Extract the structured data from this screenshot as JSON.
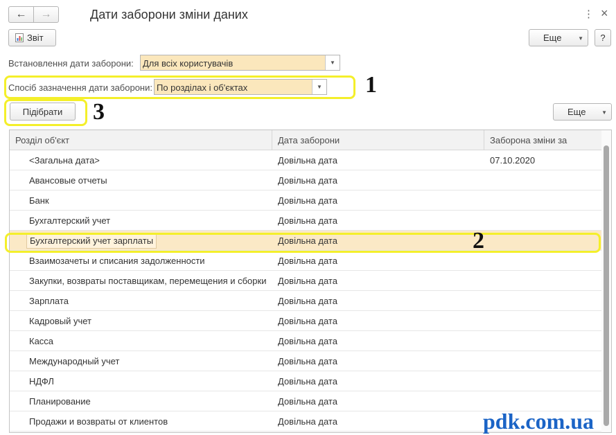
{
  "window": {
    "title": "Дати заборони зміни даних",
    "back_icon": "←",
    "forward_icon": "→",
    "menu_icon": "⋮",
    "close_icon": "×"
  },
  "toolbar": {
    "report_label": "Звіт",
    "more_label": "Еще",
    "help_label": "?"
  },
  "form": {
    "ban_date_label": "Встановлення дати заборони:",
    "ban_date_value": "Для всіх користувачів",
    "method_label": "Спосіб зазначення дати заборони:",
    "method_value": "По розділах і об'єктах"
  },
  "list_toolbar": {
    "pick_label": "Підібрати",
    "more_label": "Еще"
  },
  "table": {
    "columns": [
      "Розділ об'єкт",
      "Дата заборони",
      "Заборона зміни за"
    ],
    "rows": [
      {
        "section": "<Загальна дата>",
        "date_type": "Довільна дата",
        "ban_date": "07.10.2020"
      },
      {
        "section": "Авансовые отчеты",
        "date_type": "Довільна дата",
        "ban_date": ""
      },
      {
        "section": "Банк",
        "date_type": "Довільна дата",
        "ban_date": ""
      },
      {
        "section": "Бухгалтерский учет",
        "date_type": "Довільна дата",
        "ban_date": ""
      },
      {
        "section": "Бухгалтерский учет зарплаты",
        "date_type": "Довільна дата",
        "ban_date": "",
        "selected": true
      },
      {
        "section": "Взаимозачеты и списания задолженности",
        "date_type": "Довільна дата",
        "ban_date": ""
      },
      {
        "section": "Закупки, возвраты поставщикам, перемещения и сборки",
        "date_type": "Довільна дата",
        "ban_date": ""
      },
      {
        "section": "Зарплата",
        "date_type": "Довільна дата",
        "ban_date": ""
      },
      {
        "section": "Кадровый учет",
        "date_type": "Довільна дата",
        "ban_date": ""
      },
      {
        "section": "Касса",
        "date_type": "Довільна дата",
        "ban_date": ""
      },
      {
        "section": "Международный учет",
        "date_type": "Довільна дата",
        "ban_date": ""
      },
      {
        "section": "НДФЛ",
        "date_type": "Довільна дата",
        "ban_date": ""
      },
      {
        "section": "Планирование",
        "date_type": "Довільна дата",
        "ban_date": ""
      },
      {
        "section": "Продажи и возвраты от клиентов",
        "date_type": "Довільна дата",
        "ban_date": ""
      }
    ]
  },
  "annotations": {
    "mark_1": "1",
    "mark_2": "2",
    "mark_3": "3",
    "highlight_color": "#f4ef2a"
  },
  "watermark": "pdk.com.ua"
}
